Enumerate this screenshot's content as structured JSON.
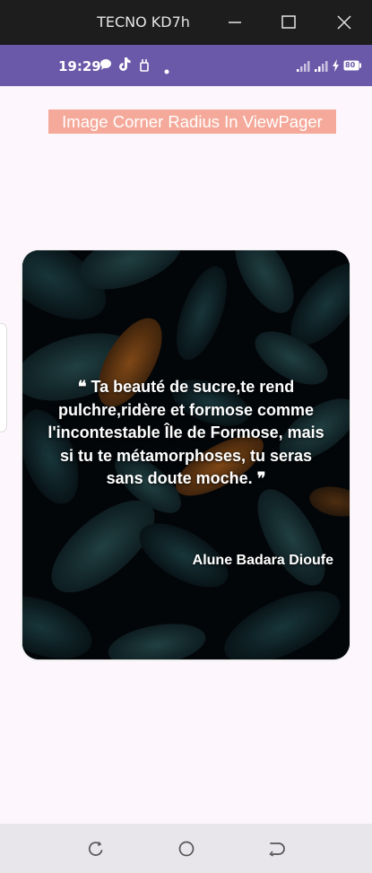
{
  "window": {
    "title": "TECNO KD7h",
    "controls": [
      "minimize-icon",
      "maximize-icon",
      "close-icon"
    ]
  },
  "status_bar": {
    "time": "19:29",
    "left_icons": [
      "chat-bubble-icon",
      "tiktok-icon",
      "usb-debug-icon",
      "notification-dot-icon"
    ],
    "right_icons": [
      "signal-1-icon",
      "signal-2-icon",
      "charging-icon"
    ],
    "battery": "80"
  },
  "heading": {
    "text": "Image Corner Radius In ViewPager",
    "background": "#f5a99a",
    "color": "#ffffff"
  },
  "card": {
    "quote_open": "❝",
    "quote": "Ta beauté de sucre,te rend pulchre,ridère et formose comme l'incontestable Île de Formose, mais si tu te métamorphoses, tu seras sans doute moche.",
    "quote_close": "❞",
    "author": "Alune Badara Dioufe"
  },
  "nav_bar": {
    "buttons": [
      "recents-icon",
      "home-icon",
      "back-icon"
    ]
  },
  "colors": {
    "status_bar": "#6a58a8",
    "title_bar": "#1d1d1d",
    "page_background": "#fdf7fd",
    "nav_bar": "#e8e6ea"
  }
}
